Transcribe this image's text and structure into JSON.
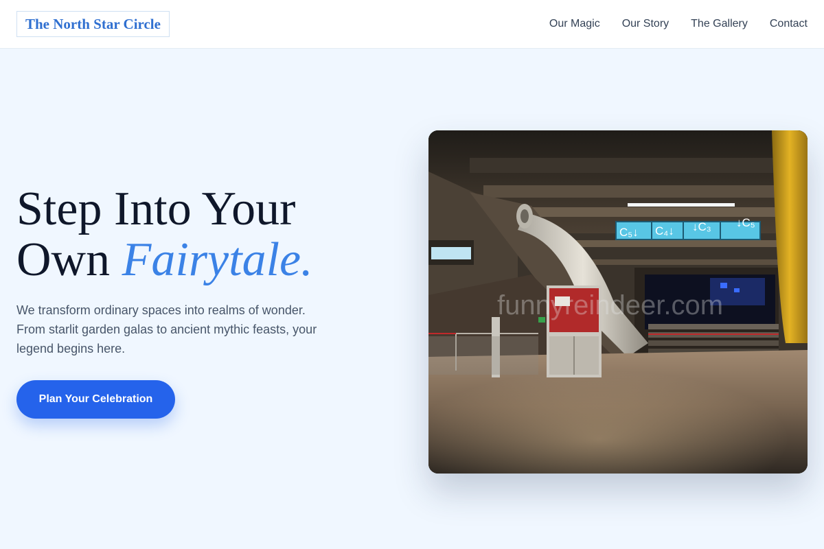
{
  "header": {
    "logo_text": "The North Star Circle",
    "nav": [
      {
        "label": "Our Magic"
      },
      {
        "label": "Our Story"
      },
      {
        "label": "The Gallery"
      },
      {
        "label": "Contact"
      }
    ]
  },
  "hero": {
    "title_line1": "Step Into Your",
    "title_line2_plain": "Own ",
    "title_line2_accent": "Fairytale.",
    "subtitle": "We transform ordinary spaces into realms of wonder. From starlit garden galas to ancient mythic feasts, your legend begins here.",
    "cta_label": "Plan Your Celebration",
    "image": {
      "watermark": "funnyreindeer.com",
      "signs": [
        "C₅↓",
        "C₄↓",
        "↓C₃",
        "↓C₅"
      ]
    }
  },
  "colors": {
    "brand": "#2f6fd0",
    "accent": "#3b82e6",
    "cta": "#2563eb",
    "page_background": "#f0f7ff",
    "heading": "#0f172a",
    "body_text": "#475569"
  }
}
